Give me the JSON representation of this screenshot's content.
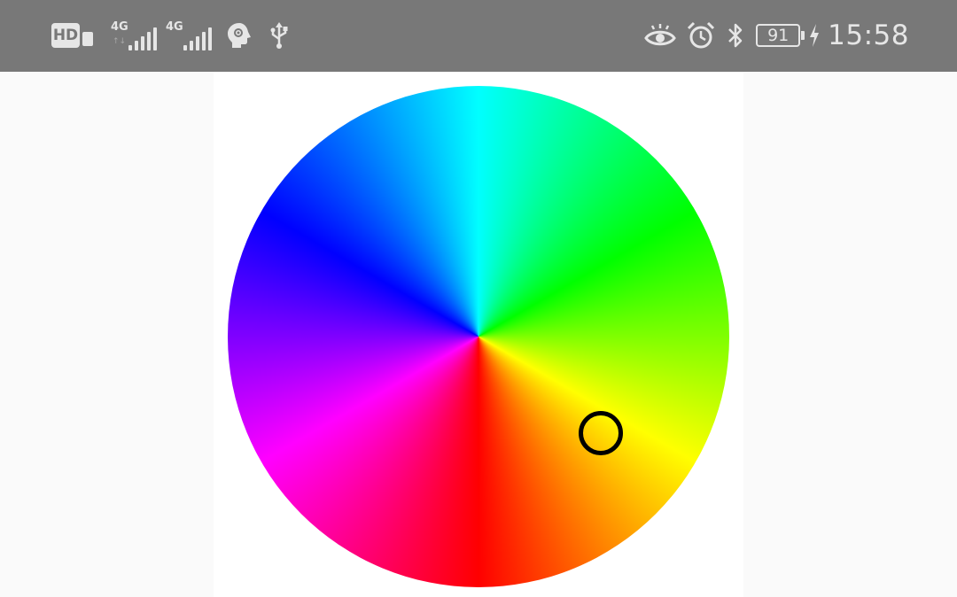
{
  "status_bar": {
    "hd_label": "HD",
    "network_1": "4G",
    "network_2": "4G",
    "data_arrows": "↑↓",
    "battery_percent": "91",
    "time": "15:58",
    "icons": [
      "hd-icon",
      "sim-icon",
      "signal-4g-icon",
      "signal-4g-icon",
      "assistant-icon",
      "usb-icon",
      "eye-comfort-icon",
      "alarm-icon",
      "bluetooth-icon",
      "battery-icon",
      "charging-icon"
    ]
  },
  "color_picker": {
    "wheel_colors": [
      "#00ffff",
      "#00ff00",
      "#ffff00",
      "#ff0000",
      "#ff00ff",
      "#0000ff"
    ],
    "selector_border": "#000000",
    "background": "#ffffff"
  }
}
